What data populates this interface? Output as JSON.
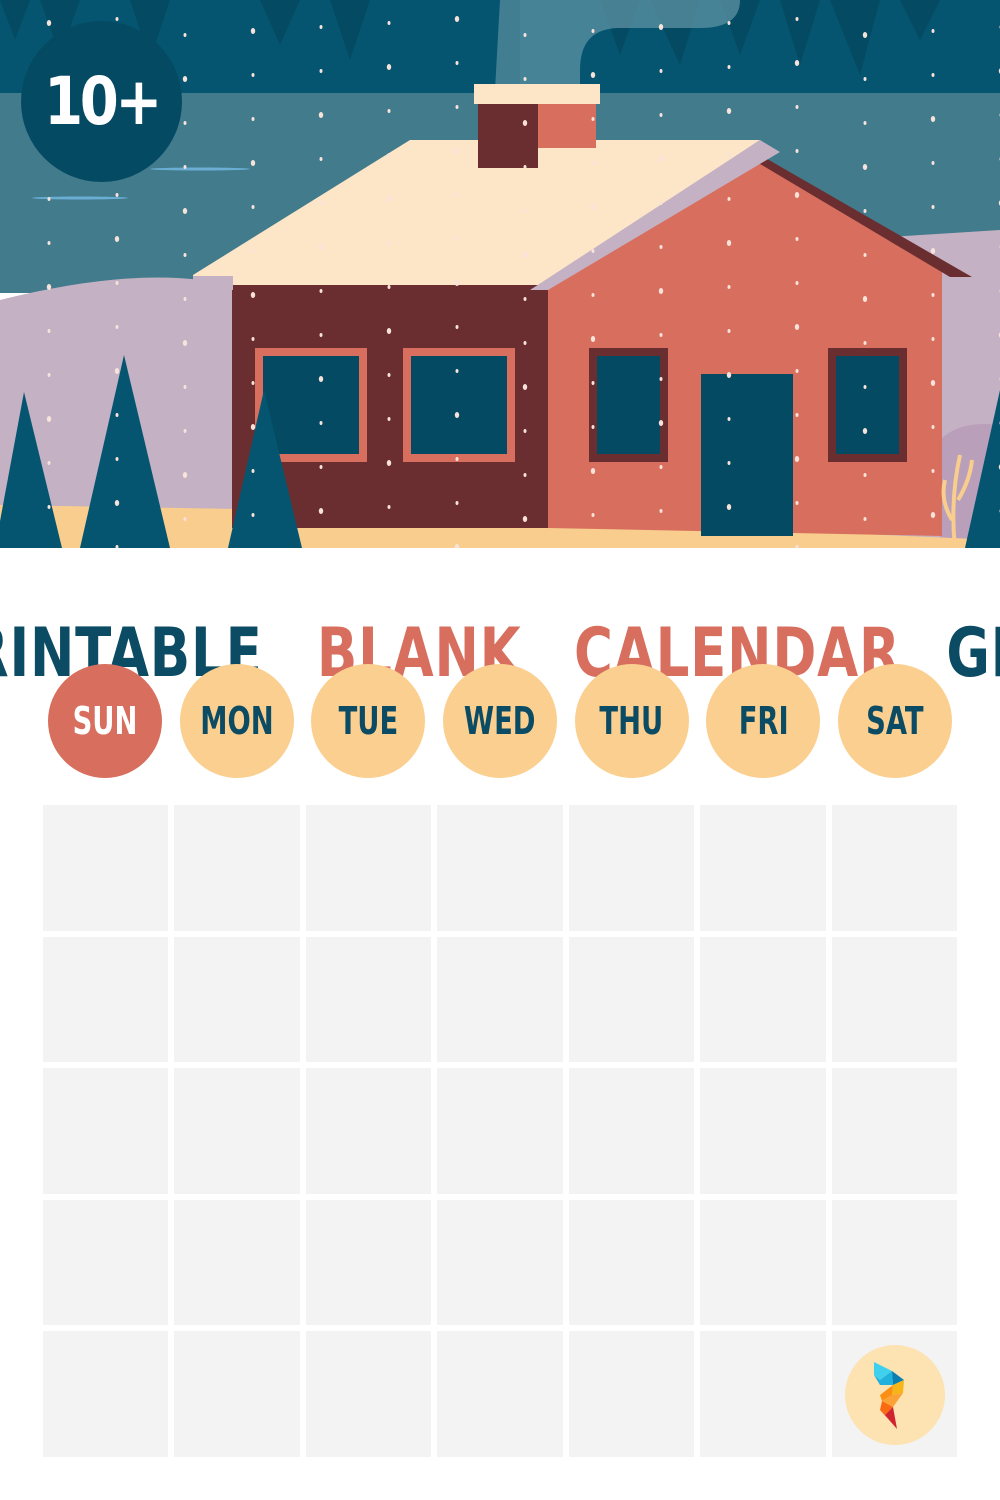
{
  "badge": {
    "text": "10+"
  },
  "title": {
    "words": [
      {
        "text": "PRINTABLE",
        "style": "dark"
      },
      {
        "text": "BLANK",
        "style": "accent"
      },
      {
        "text": "CALENDAR",
        "style": "accent"
      },
      {
        "text": "GRID",
        "style": "dark"
      }
    ]
  },
  "weekdays": [
    {
      "label": "SUN",
      "highlighted": true
    },
    {
      "label": "MON",
      "highlighted": false
    },
    {
      "label": "TUE",
      "highlighted": false
    },
    {
      "label": "WED",
      "highlighted": false
    },
    {
      "label": "THU",
      "highlighted": false
    },
    {
      "label": "FRI",
      "highlighted": false
    },
    {
      "label": "SAT",
      "highlighted": false
    }
  ],
  "calendar_grid": {
    "rows": 5,
    "columns": 7,
    "cells_filled": 0
  },
  "illustration": {
    "subject": "snowy-house-scene"
  },
  "logo": {
    "icon": "brand-logo-icon"
  },
  "colors": {
    "navy": "#0b4b63",
    "coral": "#d86f5e",
    "peach": "#fbcf8f",
    "cell": "#f3f3f3",
    "maroon": "#6a2e30",
    "lavender": "#c4b1c4",
    "roof": "#fde6c8"
  }
}
